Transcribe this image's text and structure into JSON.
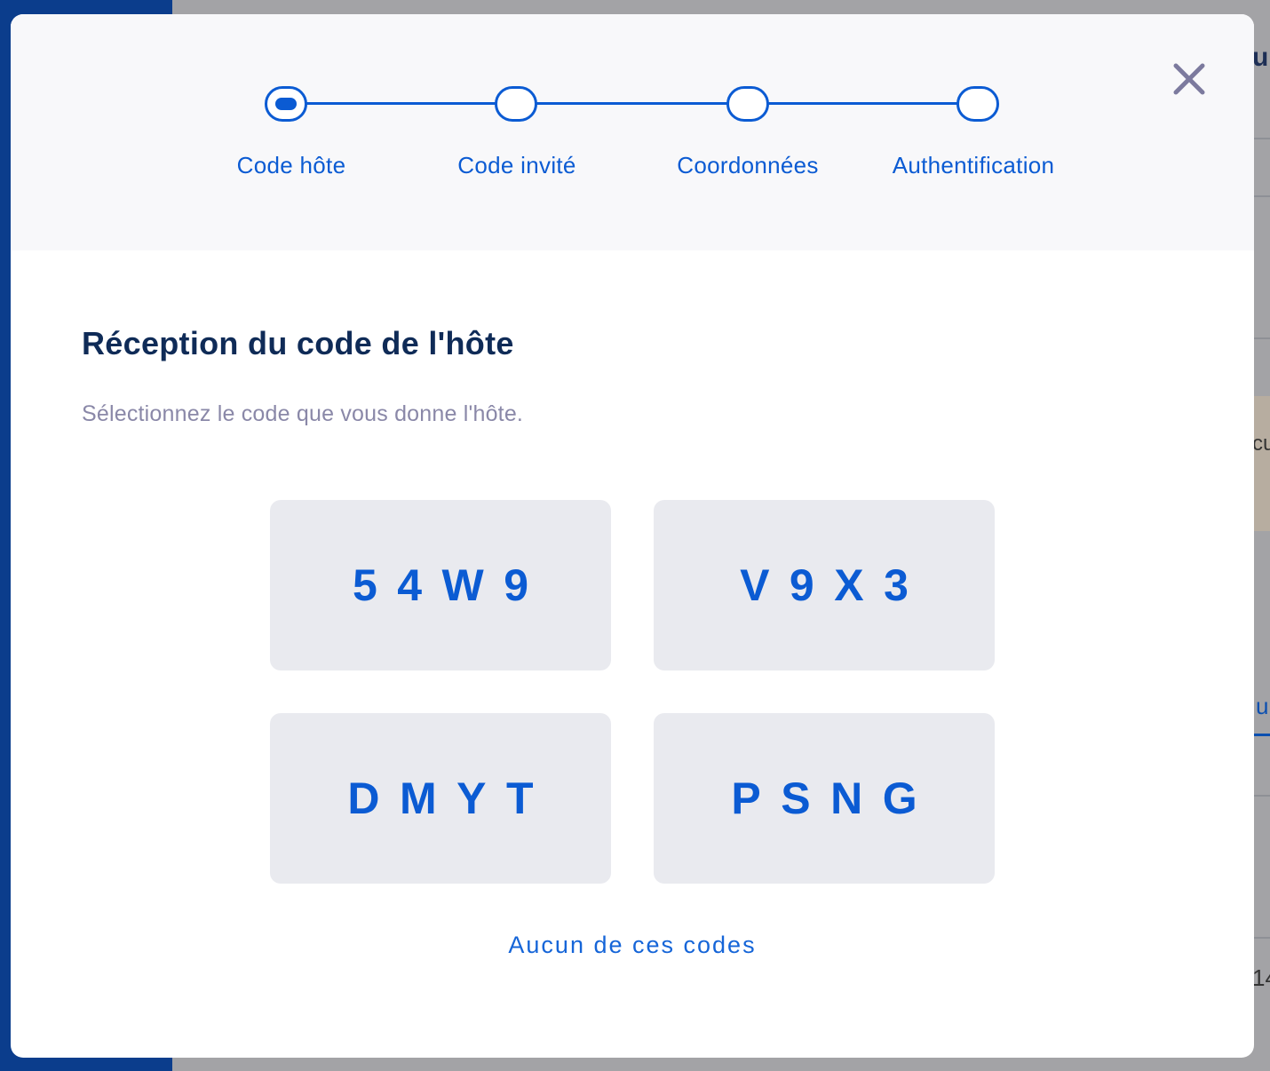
{
  "background": {
    "fragments": [
      "ub",
      "cu",
      "u",
      "14"
    ]
  },
  "stepper": {
    "steps": [
      {
        "label": "Code hôte",
        "active": true
      },
      {
        "label": "Code invité",
        "active": false
      },
      {
        "label": "Coordonnées",
        "active": false
      },
      {
        "label": "Authentification",
        "active": false
      }
    ]
  },
  "modal": {
    "title": "Réception du code de l'hôte",
    "subtitle": "Sélectionnez le code que vous donne l'hôte.",
    "codes": [
      "54W9",
      "V9X3",
      "DMYT",
      "PSNG"
    ],
    "none_link": "Aucun de ces codes"
  },
  "icons": {
    "close": "close-icon"
  },
  "colors": {
    "accent": "#0b5bd3",
    "title": "#0f2b57",
    "subtitle": "#8a88a8",
    "tile": "#e9eaef",
    "sidebar": "#0b3d8c"
  }
}
